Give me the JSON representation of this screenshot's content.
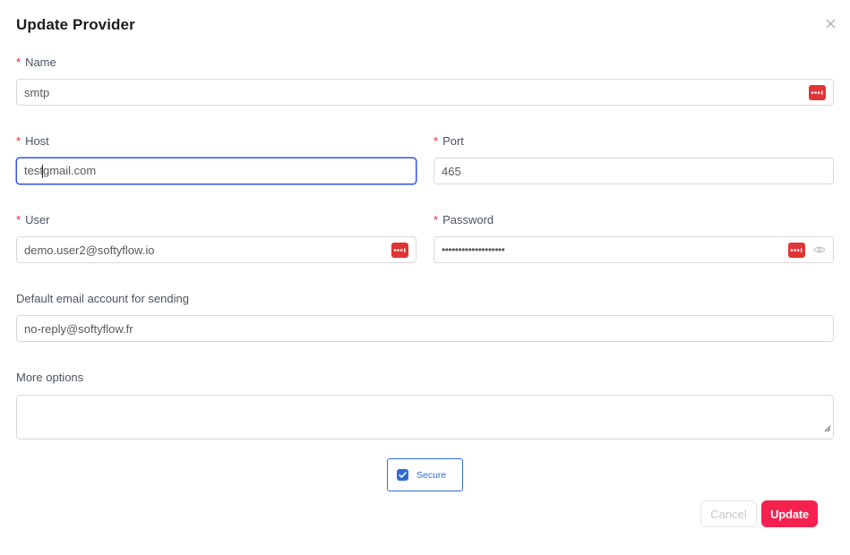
{
  "dialog": {
    "title": "Update Provider",
    "close_icon": "close-icon"
  },
  "fields": {
    "name": {
      "label": "Name",
      "required": "*",
      "value": "smtp"
    },
    "host": {
      "label": "Host",
      "required": "*",
      "value_before_caret": "test",
      "value_after_caret": "gmail.com"
    },
    "port": {
      "label": "Port",
      "required": "*",
      "value": "465"
    },
    "user": {
      "label": "User",
      "required": "*",
      "value": "demo.user2@softyflow.io"
    },
    "password": {
      "label": "Password",
      "required": "*",
      "value": "•••••••••••••••••••"
    },
    "default_email": {
      "label": "Default email account for sending",
      "value": "no-reply@softyflow.fr"
    },
    "more_options": {
      "label": "More options",
      "value": ""
    }
  },
  "secure": {
    "label": "Secure",
    "checked": true
  },
  "buttons": {
    "cancel": "Cancel",
    "update": "Update"
  },
  "colors": {
    "accent": "#2f6bd8",
    "primary": "#f5224f",
    "required": "#f5222d",
    "password_manager": "#e03535"
  }
}
